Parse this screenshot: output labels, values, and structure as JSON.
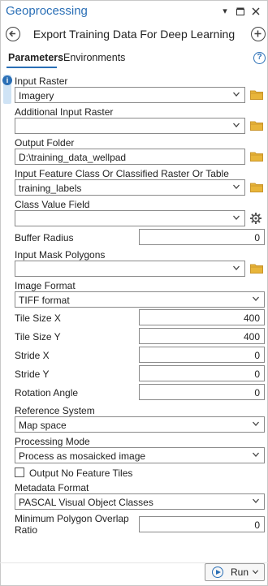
{
  "window": {
    "title": "Geoprocessing",
    "controls": [
      "pin-icon",
      "restore-icon",
      "close-icon"
    ]
  },
  "tool": {
    "title": "Export Training Data For Deep Learning",
    "back_icon": "back-arrow-icon",
    "add_icon": "add-icon"
  },
  "tabs": {
    "parameters": "Parameters",
    "environments": "Environments",
    "help": "?"
  },
  "info_icon_text": "i",
  "params": {
    "input_raster": {
      "label": "Input Raster",
      "value": "Imagery"
    },
    "additional_input_raster": {
      "label": "Additional Input Raster",
      "value": ""
    },
    "output_folder": {
      "label": "Output Folder",
      "value": "D:\\training_data_wellpad"
    },
    "input_feature_class": {
      "label": "Input Feature Class Or Classified Raster Or Table",
      "value": "training_labels"
    },
    "class_value_field": {
      "label": "Class Value Field",
      "value": ""
    },
    "buffer_radius": {
      "label": "Buffer Radius",
      "value": "0"
    },
    "input_mask_polygons": {
      "label": "Input Mask Polygons",
      "value": ""
    },
    "image_format": {
      "label": "Image Format",
      "value": "TIFF format"
    },
    "tile_size_x": {
      "label": "Tile Size X",
      "value": "400"
    },
    "tile_size_y": {
      "label": "Tile Size Y",
      "value": "400"
    },
    "stride_x": {
      "label": "Stride X",
      "value": "0"
    },
    "stride_y": {
      "label": "Stride Y",
      "value": "0"
    },
    "rotation_angle": {
      "label": "Rotation Angle",
      "value": "0"
    },
    "reference_system": {
      "label": "Reference System",
      "value": "Map space"
    },
    "processing_mode": {
      "label": "Processing Mode",
      "value": "Process as mosaicked image"
    },
    "output_no_feature_tiles": {
      "label": "Output No Feature Tiles",
      "checked": false
    },
    "metadata_format": {
      "label": "Metadata Format",
      "value": "PASCAL Visual Object Classes"
    },
    "min_polygon_overlap": {
      "label_line1": "Minimum Polygon Overlap",
      "label_line2": "Ratio",
      "value": "0"
    }
  },
  "footer": {
    "run_label": "Run"
  },
  "colors": {
    "accent": "#2a6fb6",
    "folder": "#e8b53a",
    "folder_dark": "#c9952a"
  }
}
